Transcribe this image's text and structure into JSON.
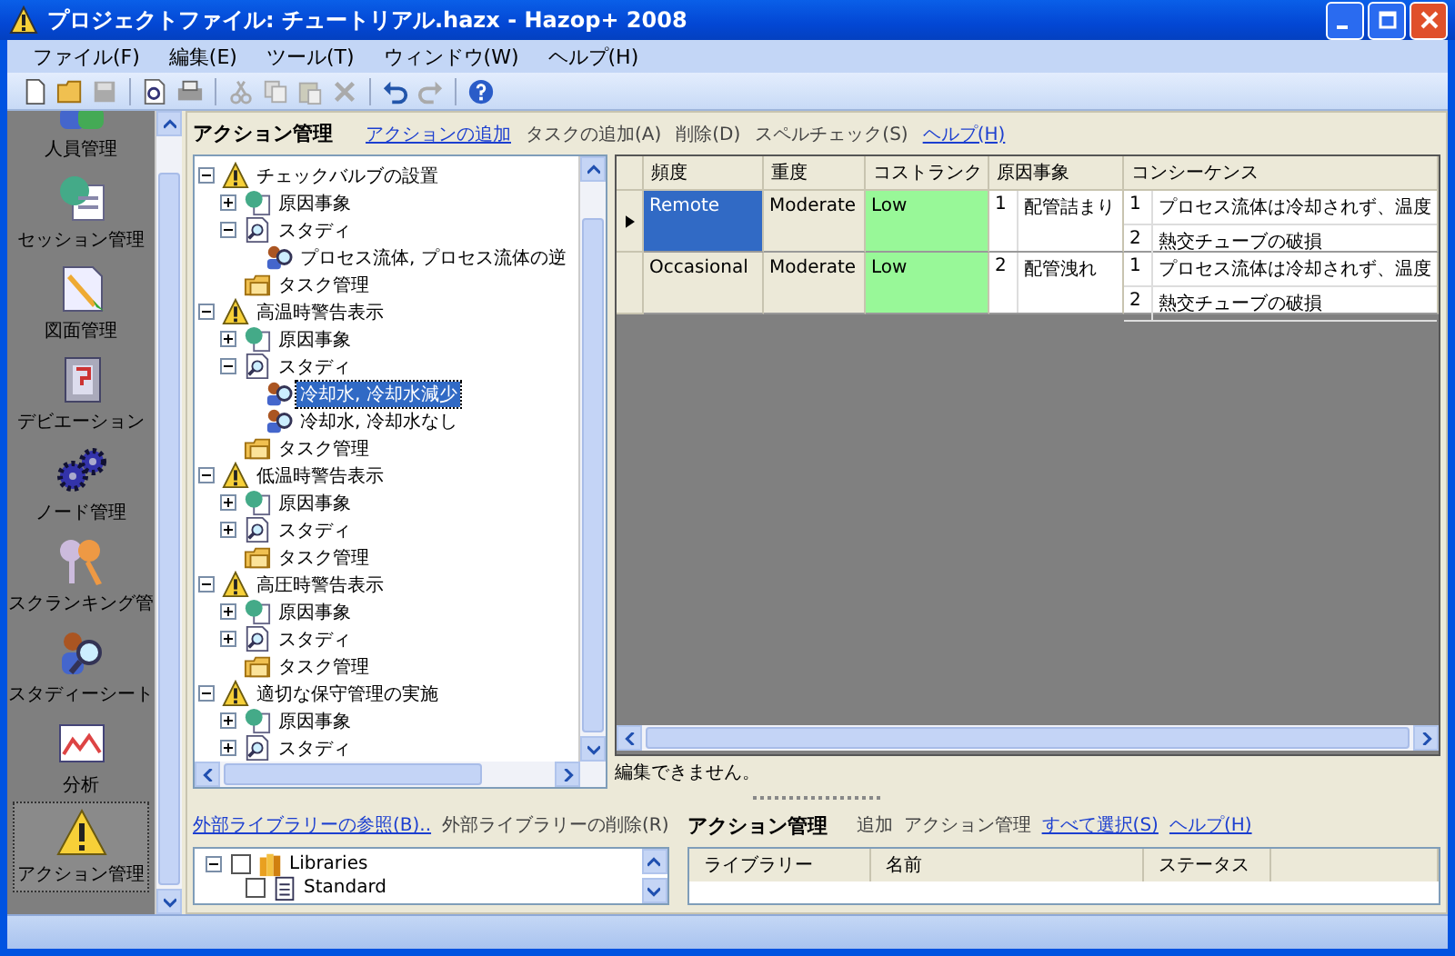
{
  "window": {
    "title": "プロジェクトファイル: チュートリアル.hazx - Hazop+ 2008"
  },
  "menu": [
    "ファイル(F)",
    "編集(E)",
    "ツール(T)",
    "ウィンドウ(W)",
    "ヘルプ(H)"
  ],
  "nav": [
    {
      "label": "人員管理",
      "kind": "people",
      "selected": false
    },
    {
      "label": "セッション管理",
      "kind": "session",
      "selected": false
    },
    {
      "label": "図面管理",
      "kind": "drawing",
      "selected": false
    },
    {
      "label": "デビエーション",
      "kind": "deviation",
      "selected": false
    },
    {
      "label": "ノード管理",
      "kind": "gears",
      "selected": false
    },
    {
      "label": "スクランキング管",
      "kind": "keys",
      "selected": false
    },
    {
      "label": "スタディーシート",
      "kind": "study",
      "selected": false
    },
    {
      "label": "分析",
      "kind": "chart",
      "selected": false
    },
    {
      "label": "アクション管理",
      "kind": "warning",
      "selected": true
    }
  ],
  "header": {
    "title": "アクション管理",
    "actions": [
      {
        "label": "アクションの追加",
        "link": true
      },
      {
        "label": "タスクの追加(A)",
        "link": false
      },
      {
        "label": "削除(D)",
        "link": false
      },
      {
        "label": "スペルチェック(S)",
        "link": false
      },
      {
        "label": "ヘルプ(H)",
        "link": true
      }
    ]
  },
  "tree": [
    {
      "label": "チェックバルブの設置",
      "kind": "warning",
      "expanded": true,
      "selected": false,
      "children": [
        {
          "label": "原因事象",
          "kind": "cause",
          "expanded": false,
          "selected": false
        },
        {
          "label": "スタディ",
          "kind": "study",
          "expanded": true,
          "selected": false,
          "children": [
            {
              "label": "プロセス流体, プロセス流体の逆",
              "kind": "person",
              "selected": false
            }
          ]
        },
        {
          "label": "タスク管理",
          "kind": "task",
          "selected": false
        }
      ]
    },
    {
      "label": "高温時警告表示",
      "kind": "warning",
      "expanded": true,
      "selected": false,
      "children": [
        {
          "label": "原因事象",
          "kind": "cause",
          "expanded": false,
          "selected": false
        },
        {
          "label": "スタディ",
          "kind": "study",
          "expanded": true,
          "selected": false,
          "children": [
            {
              "label": "冷却水, 冷却水減少",
              "kind": "person",
              "selected": true
            },
            {
              "label": "冷却水, 冷却水なし",
              "kind": "person",
              "selected": false
            }
          ]
        },
        {
          "label": "タスク管理",
          "kind": "task",
          "selected": false
        }
      ]
    },
    {
      "label": "低温時警告表示",
      "kind": "warning",
      "expanded": true,
      "selected": false,
      "children": [
        {
          "label": "原因事象",
          "kind": "cause",
          "expanded": false,
          "selected": false
        },
        {
          "label": "スタディ",
          "kind": "study",
          "expanded": false,
          "selected": false
        },
        {
          "label": "タスク管理",
          "kind": "task",
          "selected": false
        }
      ]
    },
    {
      "label": "高圧時警告表示",
      "kind": "warning",
      "expanded": true,
      "selected": false,
      "children": [
        {
          "label": "原因事象",
          "kind": "cause",
          "expanded": false,
          "selected": false
        },
        {
          "label": "スタディ",
          "kind": "study",
          "expanded": false,
          "selected": false
        },
        {
          "label": "タスク管理",
          "kind": "task",
          "selected": false
        }
      ]
    },
    {
      "label": "適切な保守管理の実施",
      "kind": "warning",
      "expanded": true,
      "selected": false,
      "children": [
        {
          "label": "原因事象",
          "kind": "cause",
          "expanded": false,
          "selected": false
        },
        {
          "label": "スタディ",
          "kind": "study",
          "expanded": false,
          "selected": false
        }
      ]
    }
  ],
  "grid": {
    "columns": [
      "頻度",
      "重度",
      "コストランク",
      "原因事象",
      "コンシーケンス"
    ],
    "rows": [
      {
        "current": true,
        "frequency": "Remote",
        "frequency_selected": true,
        "severity": "Moderate",
        "cost_rank": "Low",
        "cause_no": "1",
        "cause": "配管詰まり",
        "consequences": [
          {
            "no": "1",
            "text": "プロセス流体は冷却されず、温度"
          },
          {
            "no": "2",
            "text": "熱交チューブの破損"
          }
        ]
      },
      {
        "current": false,
        "frequency": "Occasional",
        "frequency_selected": false,
        "severity": "Moderate",
        "cost_rank": "Low",
        "cause_no": "2",
        "cause": "配管洩れ",
        "consequences": [
          {
            "no": "1",
            "text": "プロセス流体は冷却されず、温度"
          },
          {
            "no": "2",
            "text": "熱交チューブの破損"
          }
        ]
      }
    ],
    "status": "編集できません。"
  },
  "library": {
    "actions": [
      {
        "label": "外部ライブラリーの参照(B)..",
        "link": true
      },
      {
        "label": "外部ライブラリーの削除(R)",
        "link": false
      }
    ],
    "tree": [
      {
        "label": "Libraries",
        "expanded": true,
        "checked": false,
        "children": [
          {
            "label": "Standard",
            "checked": false
          }
        ]
      }
    ]
  },
  "library_actions": {
    "title": "アクション管理",
    "actions": [
      {
        "label": "追加",
        "link": false
      },
      {
        "label": "アクション管理",
        "link": false
      },
      {
        "label": "すべて選択(S)",
        "link": true
      },
      {
        "label": "ヘルプ(H)",
        "link": true
      }
    ],
    "columns": [
      "ライブラリー",
      "名前",
      "ステータス"
    ]
  }
}
